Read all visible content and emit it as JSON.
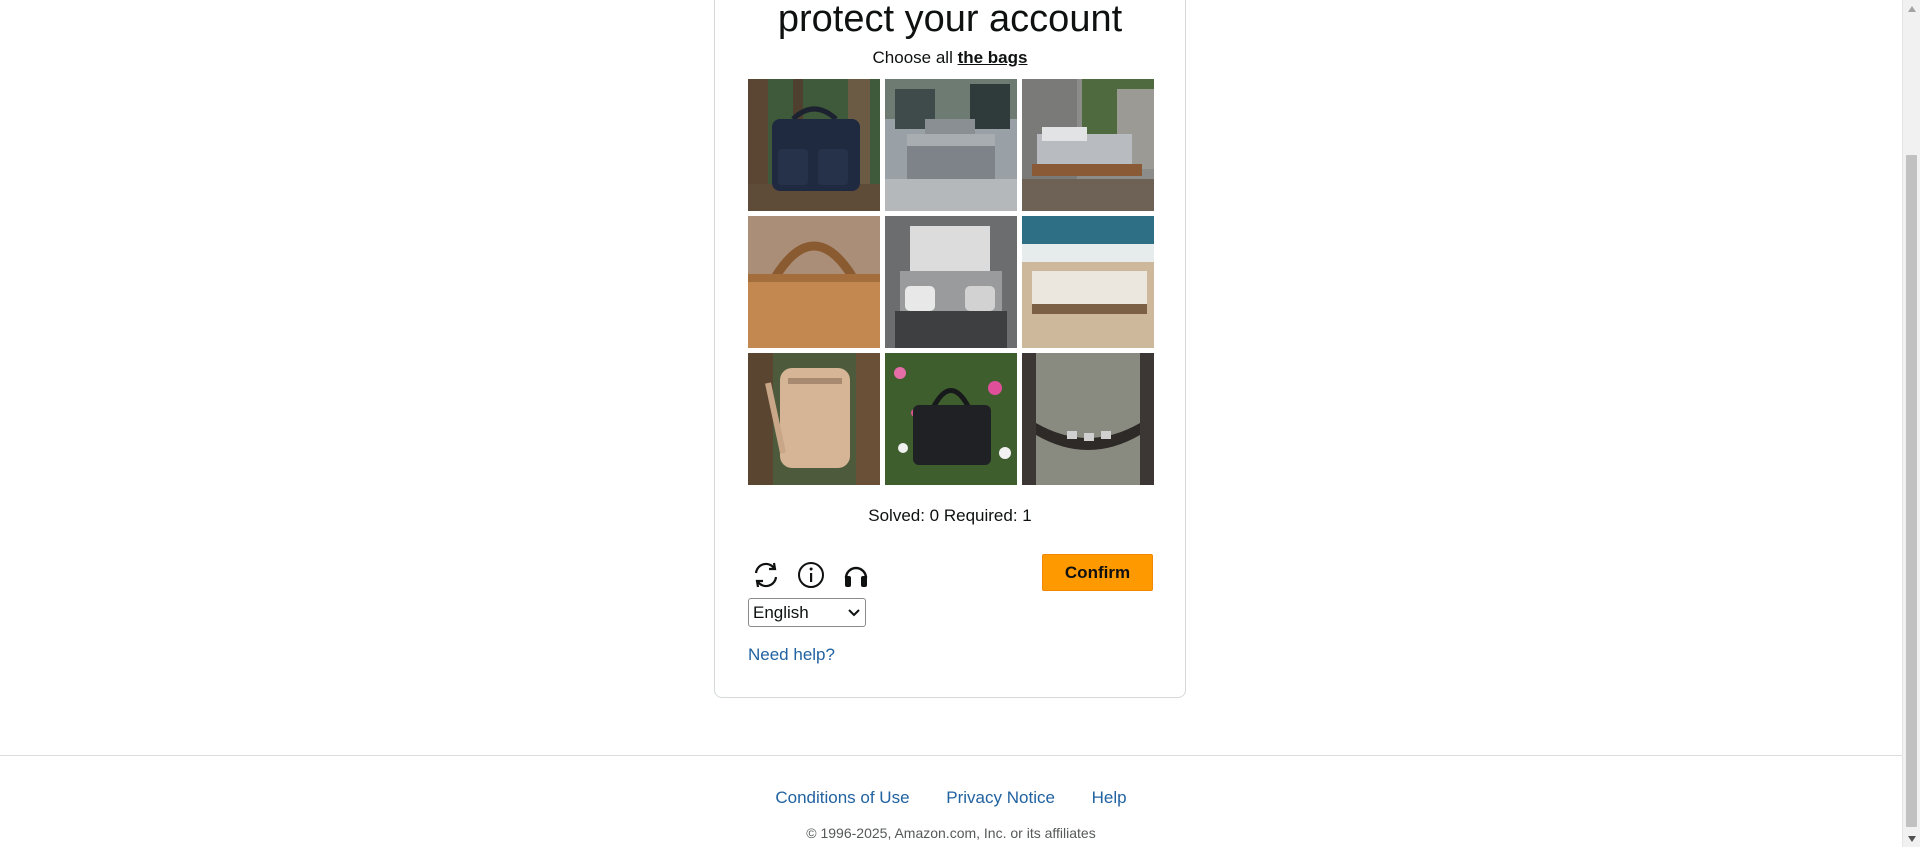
{
  "captcha": {
    "title": "protect your account",
    "instruction_prefix": "Choose all",
    "instruction_target": "the bags",
    "tiles": [
      {
        "name": "bag-dark-forest",
        "subject": "bag"
      },
      {
        "name": "bed-modern-house",
        "subject": "bed"
      },
      {
        "name": "bed-wooden-deck",
        "subject": "bed"
      },
      {
        "name": "bag-tan-handle",
        "subject": "bag"
      },
      {
        "name": "bed-gray-bedroom",
        "subject": "bed"
      },
      {
        "name": "bed-beach",
        "subject": "bed"
      },
      {
        "name": "backpack-beige-forest",
        "subject": "bag"
      },
      {
        "name": "bag-black-flowers",
        "subject": "bag"
      },
      {
        "name": "chair-back-closeup",
        "subject": "chair"
      }
    ],
    "status": "Solved: 0 Required: 1",
    "refresh_icon": "refresh-icon",
    "info_icon": "info-icon",
    "audio_icon": "headphones-icon",
    "confirm_label": "Confirm",
    "language_selected": "English",
    "need_help_label": "Need help?"
  },
  "footer": {
    "links": [
      "Conditions of Use",
      "Privacy Notice",
      "Help"
    ],
    "copyright": "© 1996-2025, Amazon.com, Inc. or its affiliates"
  },
  "colors": {
    "accent_button": "#ff9900",
    "link": "#2162a1",
    "text": "#0f1111"
  }
}
